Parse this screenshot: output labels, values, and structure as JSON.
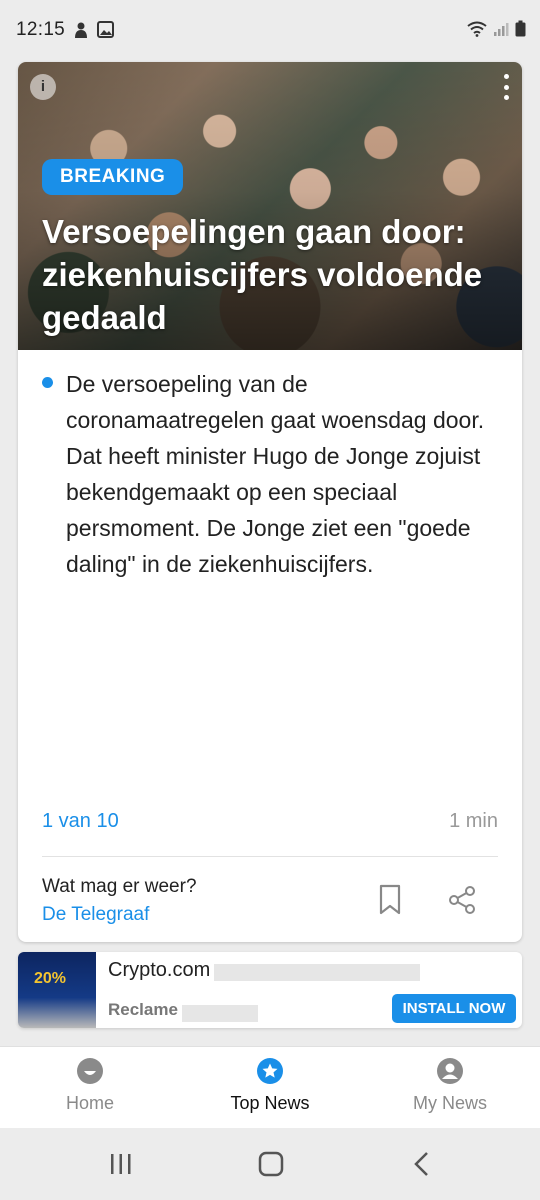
{
  "status_bar": {
    "time": "12:15"
  },
  "article": {
    "badge": "BREAKING",
    "headline": "Versoepelingen gaan door: ziekenhuiscijfers voldoende gedaald",
    "body": "De versoepeling van de coronamaatregelen gaat woensdag door. Dat heeft minister Hugo de Jonge zojuist bekendgemaakt op een speciaal persmoment. De Jonge ziet een \"goede daling\" in de ziekenhuiscijfers.",
    "page_indicator": "1 van 10",
    "read_time": "1 min",
    "related_title": "Wat mag er weer?",
    "source": "De Telegraaf"
  },
  "ad": {
    "thumb_text": "20%",
    "title": "Crypto.com",
    "label": "Reclame",
    "cta": "INSTALL NOW"
  },
  "bottom_nav": {
    "items": [
      {
        "label": "Home",
        "icon": "home-icon",
        "active": false
      },
      {
        "label": "Top News",
        "icon": "star-icon",
        "active": true
      },
      {
        "label": "My News",
        "icon": "person-icon",
        "active": false
      }
    ]
  },
  "colors": {
    "accent": "#1a8fe8",
    "muted": "#999999",
    "inactive_nav": "#8a8a8a"
  }
}
